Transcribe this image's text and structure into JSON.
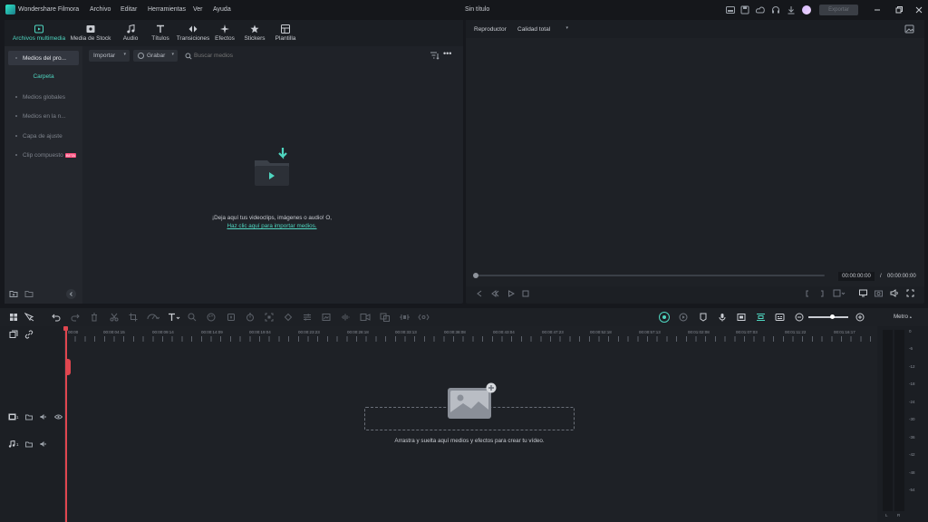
{
  "titlebar": {
    "app_name": "Wondershare Filmora",
    "menu": [
      "Archivo",
      "Editar",
      "Herramientas",
      "Ver",
      "Ayuda"
    ],
    "project_title": "Sin título",
    "export_label": "Exportar"
  },
  "library": {
    "tabs": [
      {
        "label": "Archivos multimedia",
        "icon": "media-files-icon"
      },
      {
        "label": "Media de Stock",
        "icon": "stock-media-icon"
      },
      {
        "label": "Audio",
        "icon": "music-note-icon"
      },
      {
        "label": "Títulos",
        "icon": "text-title-icon"
      },
      {
        "label": "Transiciones",
        "icon": "transitions-icon"
      },
      {
        "label": "Efectos",
        "icon": "effects-sparkle-icon"
      },
      {
        "label": "Stickers",
        "icon": "stickers-icon"
      },
      {
        "label": "Plantilla",
        "icon": "template-icon"
      }
    ],
    "sidebar": {
      "items": [
        "Medios del pro...",
        "Carpeta",
        "Medios globales",
        "Medios en la n...",
        "Capa de ajuste",
        "Clip compuesto"
      ],
      "beta_badge": "BETA"
    },
    "toolbar": {
      "import_label": "Importar",
      "record_label": "Grabar",
      "search_placeholder": "Buscar medios"
    },
    "empty": {
      "message": "¡Deja aquí tus videoclips, imágenes o audio! O,",
      "link": "Haz clic aquí para importar medios."
    }
  },
  "player": {
    "label": "Reproductor",
    "quality": "Calidad total",
    "current_time": "00:00:00:00",
    "separator": "/",
    "total_time": "00:00:00:00"
  },
  "timeline": {
    "ruler": [
      "00:00",
      "00:00:04:15",
      "00:00:09:14",
      "00:00:14:09",
      "00:00:19:04",
      "00:00:23:23",
      "00:00:28:18",
      "00:00:33:13",
      "00:00:38:08",
      "00:00:43:04",
      "00:00:47:23",
      "00:00:52:18",
      "00:00:57:13",
      "00:01:02:08",
      "00:01:07:03",
      "00:01:11:22",
      "00:01:16:17"
    ],
    "drop_hint": "Arrastra y suelta aquí medios y efectos para crear tu vídeo.",
    "video_track": "1",
    "audio_track": "1",
    "meter_label": "Metro",
    "meter_scale": [
      "0",
      "-6",
      "-12",
      "-18",
      "-24",
      "-30",
      "-36",
      "-42",
      "-48",
      "-54"
    ],
    "meter_channels": [
      "L",
      "R"
    ],
    "colors": {
      "accent": "#4fd6c0",
      "playhead": "#e0464f"
    }
  }
}
